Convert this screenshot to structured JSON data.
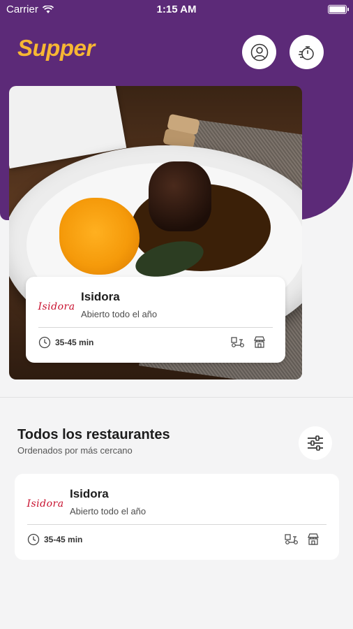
{
  "status_bar": {
    "carrier": "Carrier",
    "time": "1:15 AM"
  },
  "header": {
    "logo": "Supper"
  },
  "featured": {
    "brand_text": "Isidora",
    "name": "Isidora",
    "status": "Abierto todo el año",
    "time": "35-45 min"
  },
  "section": {
    "title": "Todos los restaurantes",
    "subtitle": "Ordenados por más cercano"
  },
  "restaurants": [
    {
      "brand_text": "Isidora",
      "name": "Isidora",
      "status": "Abierto todo el año",
      "time": "35-45 min"
    }
  ],
  "colors": {
    "primary": "#5c2a78",
    "logo": "#f7b733",
    "brand_red": "#c8102e"
  },
  "icons": {
    "profile": "user-icon",
    "orders": "stopwatch-icon",
    "filter": "sliders-icon",
    "delivery": "scooter-icon",
    "pickup": "store-icon",
    "time": "clock-icon"
  }
}
